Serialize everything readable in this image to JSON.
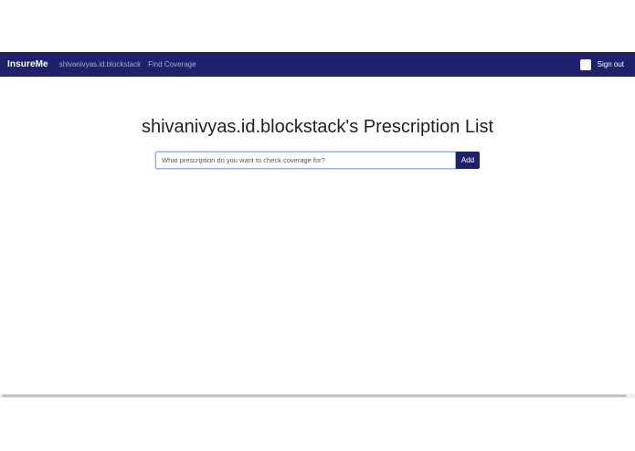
{
  "navbar": {
    "brand": "InsureMe",
    "links": [
      {
        "label": "shivanivyas.id.blockstack"
      },
      {
        "label": "Find Coverage"
      }
    ],
    "signout_label": "Sign out",
    "background": "#1f216b"
  },
  "main": {
    "title": "shivanivyas.id.blockstack's Prescription List",
    "search": {
      "value": "",
      "placeholder": "What prescription do you want to check coverage for?"
    },
    "add_label": "Add"
  }
}
